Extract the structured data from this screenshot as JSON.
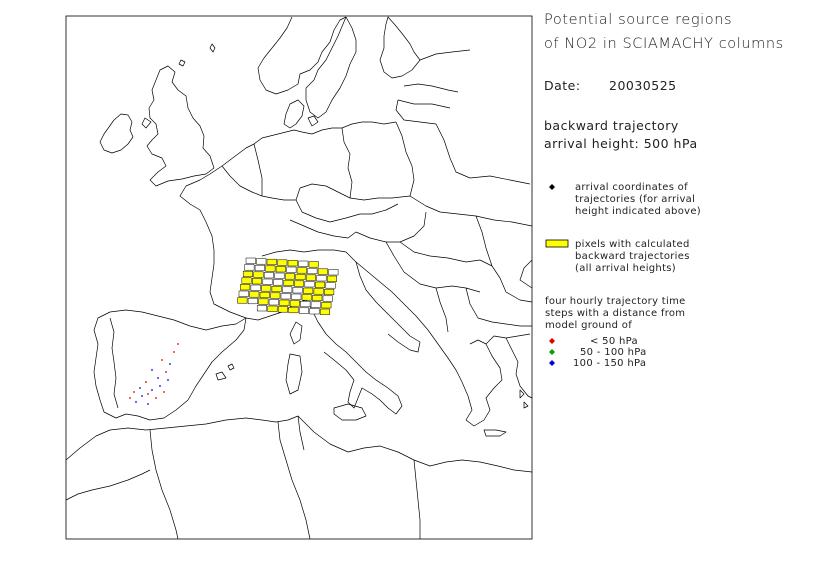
{
  "title_line1": "Potential source regions",
  "title_line2": "of NO2 in SCIAMACHY columns",
  "date_label": "Date:",
  "date_value": "20030525",
  "trajectory_line1": "backward trajectory",
  "trajectory_line2": "arrival height: 500 hPa",
  "legend": {
    "arrival": {
      "symbol": "diamond",
      "color": "#000000",
      "lines": [
        "arrival coordinates of",
        "trajectories (for arrival",
        "height indicated above)"
      ]
    },
    "pixels": {
      "fill": "#ffff00",
      "lines": [
        "pixels with calculated",
        "backward trajectories",
        "(all arrival heights)"
      ]
    },
    "time_steps": {
      "lines": [
        "four hourly trajectory time",
        "steps with a distance from",
        "model ground of"
      ]
    },
    "levels": [
      {
        "color": "#e00000",
        "label": "< 50 hPa"
      },
      {
        "color": "#00a000",
        "label": "50 - 100 hPa"
      },
      {
        "color": "#0000e0",
        "label": "100 - 150 hPa"
      }
    ]
  },
  "colors": {
    "coastline": "#000000",
    "pixel_yellow": "#ffff00",
    "pixel_grey": "#ffffff"
  }
}
